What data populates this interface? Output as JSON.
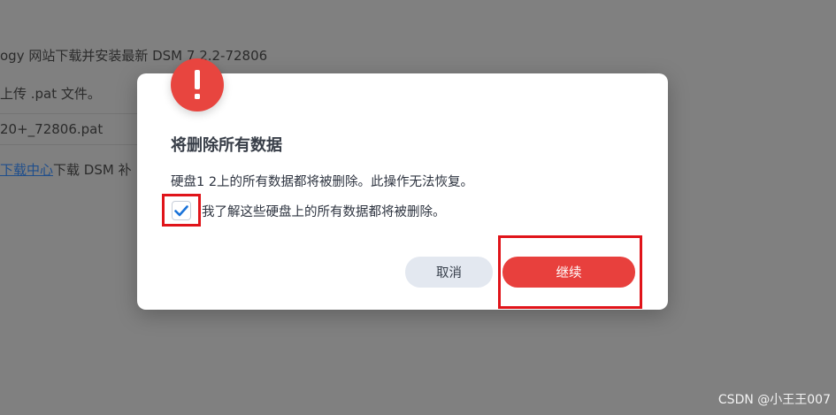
{
  "background_page": {
    "lines": [
      "ogy 网站下载并安装最新 DSM 7.2.2-72806",
      "上传 .pat 文件。",
      "20+_72806.pat"
    ],
    "line4_link": "下载中心",
    "line4_rest": "下载 DSM 补"
  },
  "dialog": {
    "icon": "exclamation-icon",
    "title": "将删除所有数据",
    "message": "硬盘1 2上的所有数据都将被删除。此操作无法恢复。",
    "checkbox": {
      "checked": true,
      "label": "我了解这些硬盘上的所有数据都将被删除。"
    },
    "buttons": {
      "cancel": "取消",
      "continue": "继续"
    }
  },
  "colors": {
    "accent_red": "#e8403d",
    "highlight_red": "#e0141a",
    "check_blue": "#1a73d9",
    "overlay_gray": "#808080"
  },
  "watermark": "CSDN @小王王007"
}
